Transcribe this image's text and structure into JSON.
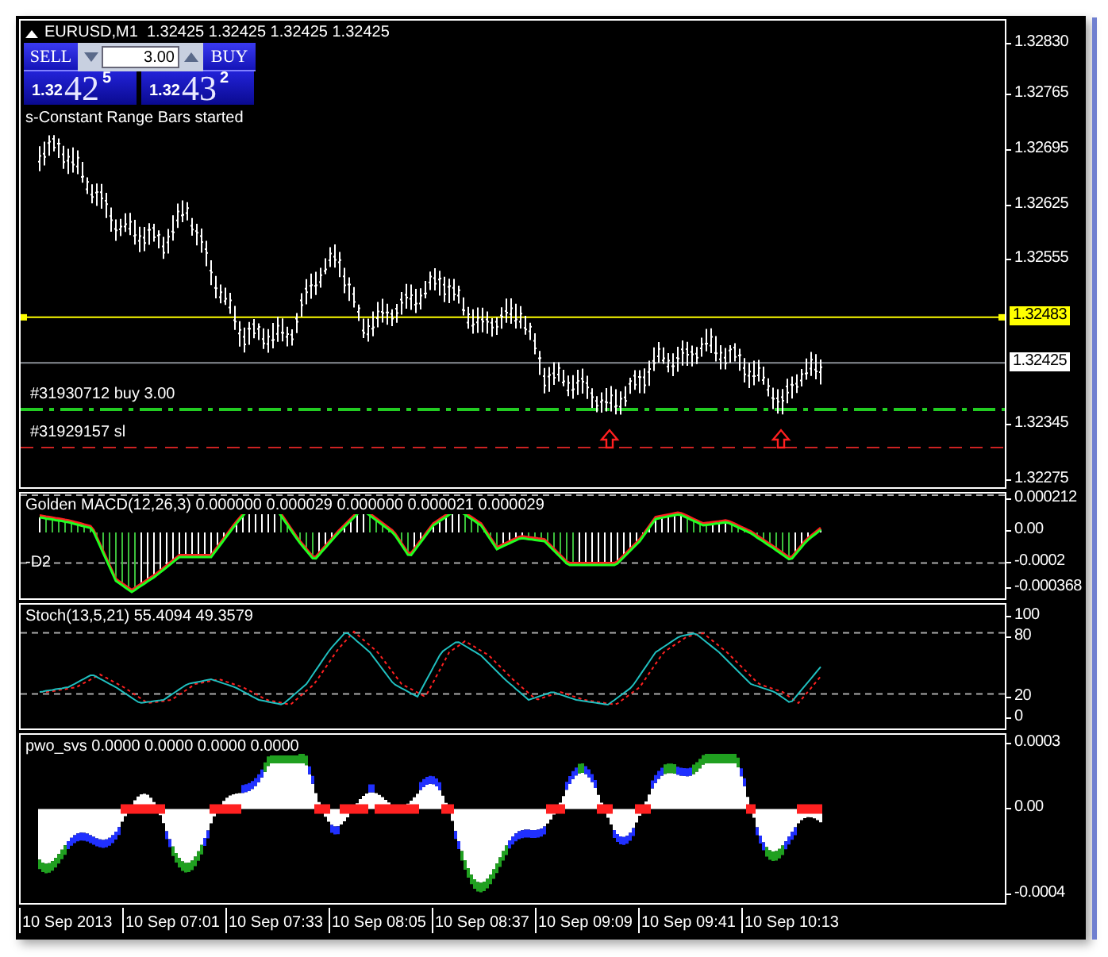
{
  "chart": {
    "symbol_line": "EURUSD,M1  1.32425 1.32425 1.32425 1.32425",
    "trade_panel": {
      "sell_label": "SELL",
      "lot": "3.00",
      "buy_label": "BUY",
      "sell_price": {
        "base": "1.32",
        "big": "42",
        "small": "5"
      },
      "buy_price": {
        "base": "1.32",
        "big": "43",
        "small": "2"
      }
    },
    "status_text": "s-Constant Range Bars started",
    "order_lines": [
      {
        "label": "#31930712 buy 3.00",
        "kind": "buy"
      },
      {
        "label": "#31929157 sl",
        "kind": "sl"
      }
    ],
    "price_axis": [
      {
        "label": "1.32830",
        "kind": "tick"
      },
      {
        "label": "1.32765",
        "kind": "tick"
      },
      {
        "label": "1.32695",
        "kind": "tick"
      },
      {
        "label": "1.32625",
        "kind": "tick"
      },
      {
        "label": "1.32555",
        "kind": "tick"
      },
      {
        "label": "1.32483",
        "kind": "line"
      },
      {
        "label": "1.32425",
        "kind": "bid"
      },
      {
        "label": "1.32345",
        "kind": "tick"
      },
      {
        "label": "1.32275",
        "kind": "tick"
      }
    ]
  },
  "macd": {
    "title": "Golden MACD(12,26,3) 0.000000 0.000029 0.000000 0.000021 0.000029",
    "sub_label": "-D2",
    "axis": [
      "0.000212",
      "0.00",
      "-0.0002",
      "-0.000368"
    ]
  },
  "stoch": {
    "title": "Stoch(13,5,21) 55.4094 49.3579",
    "axis": [
      "100",
      "80",
      "20",
      "0"
    ]
  },
  "pwo": {
    "title": "pwo_svs 0.0000 0.0000 0.0000 0.0000",
    "axis": [
      "0.0003",
      "0.00",
      "-0.0004"
    ]
  },
  "time_axis": [
    "10 Sep 2013",
    "10 Sep 07:01",
    "10 Sep 07:33",
    "10 Sep 08:05",
    "10 Sep 08:37",
    "10 Sep 09:09",
    "10 Sep 09:41",
    "10 Sep 10:13"
  ]
}
